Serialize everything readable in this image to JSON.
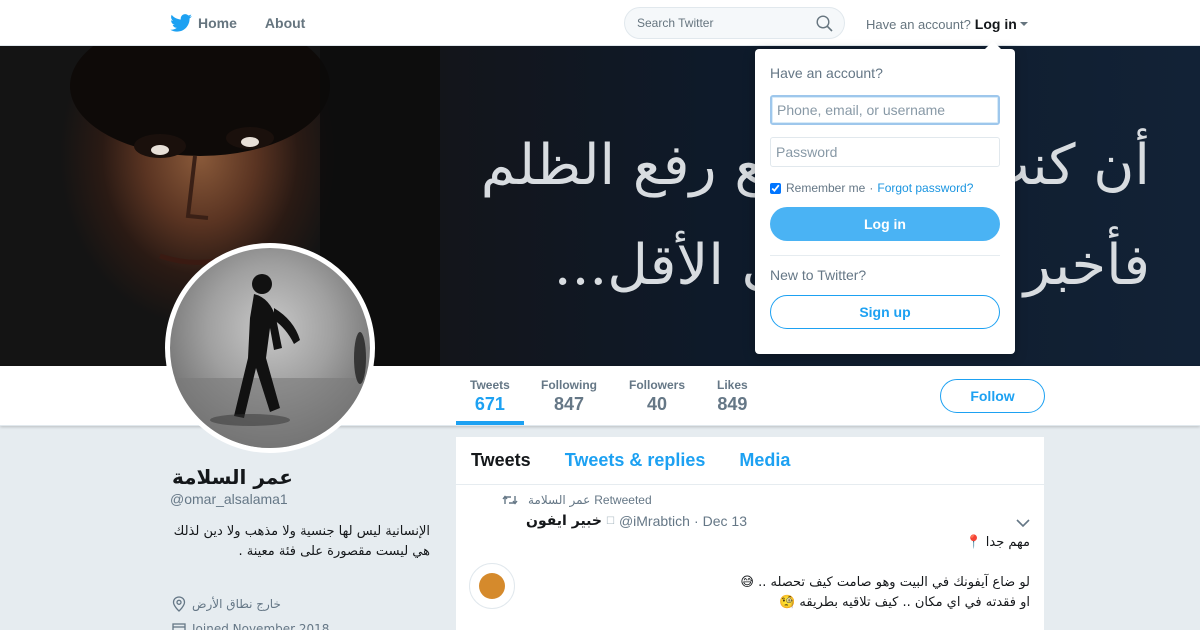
{
  "nav": {
    "home_label": "Home",
    "about_label": "About",
    "search_placeholder": "Search Twitter",
    "account_prompt": "Have an account?",
    "login_link": "Log in"
  },
  "banner": {
    "text_line1": "أن كنت لا تستطيع رفع الظلم",
    "text_line2": "فأخبر الجميع على الأقل..."
  },
  "profile": {
    "name": "عمر السلامة",
    "handle": "@omar_alsalama1",
    "bio": "الإنسانية ليس لها جنسية ولا مذهب ولا دين لذلك هي ليست مقصورة على فئة معينة .",
    "location": "خارج نطاق الأرض",
    "joined": "Joined November 2018"
  },
  "stats": [
    {
      "label": "Tweets",
      "value": "671"
    },
    {
      "label": "Following",
      "value": "847"
    },
    {
      "label": "Followers",
      "value": "40"
    },
    {
      "label": "Likes",
      "value": "849"
    }
  ],
  "follow_label": "Follow",
  "timeline": {
    "tabs": [
      "Tweets",
      "Tweets & replies",
      "Media"
    ],
    "tweet": {
      "retweeter": "عمر السلامة",
      "retweeted_label": "Retweeted",
      "author_name": "خبير ايفون",
      "author_handle": "@iMrabtich",
      "date": "Dec 13",
      "line1": "مهم جدا 📍",
      "line2": "لو ضاع آيفونك في البيت وهو صامت كيف تحصله .. 😅",
      "line3": "او فقدته في اي مكان .. كيف تلاقيه بطريقه 🧐"
    }
  },
  "login_dropdown": {
    "heading": "Have an account?",
    "username_placeholder": "Phone, email, or username",
    "password_placeholder": "Password",
    "remember_label": "Remember me",
    "separator": "·",
    "forgot_label": "Forgot password?",
    "login_button": "Log in",
    "new_prompt": "New to Twitter?",
    "signup_button": "Sign up"
  },
  "colors": {
    "accent": "#1da1f2",
    "login_button": "#4ab3f4",
    "page_bg": "#e6ecf0"
  }
}
